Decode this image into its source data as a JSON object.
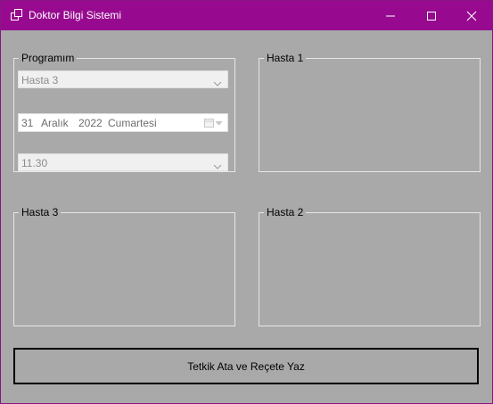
{
  "window": {
    "title": "Doktor Bilgi Sistemi"
  },
  "program_group": {
    "label": "Programım",
    "patient_select": {
      "value": "Hasta 3"
    },
    "date_picker": {
      "day": "31",
      "month": "Aralık",
      "year": "2022",
      "weekday": "Cumartesi"
    },
    "time_select": {
      "value": "11.30"
    }
  },
  "patient_groups": {
    "hasta1": "Hasta 1",
    "hasta2": "Hasta 2",
    "hasta3": "Hasta 3"
  },
  "action_button": {
    "label": "Tetkik Ata ve Reçete Yaz"
  },
  "colors": {
    "titlebar": "#970a8f",
    "background": "#a9a9a9",
    "group_border": "#e6e6e6"
  }
}
